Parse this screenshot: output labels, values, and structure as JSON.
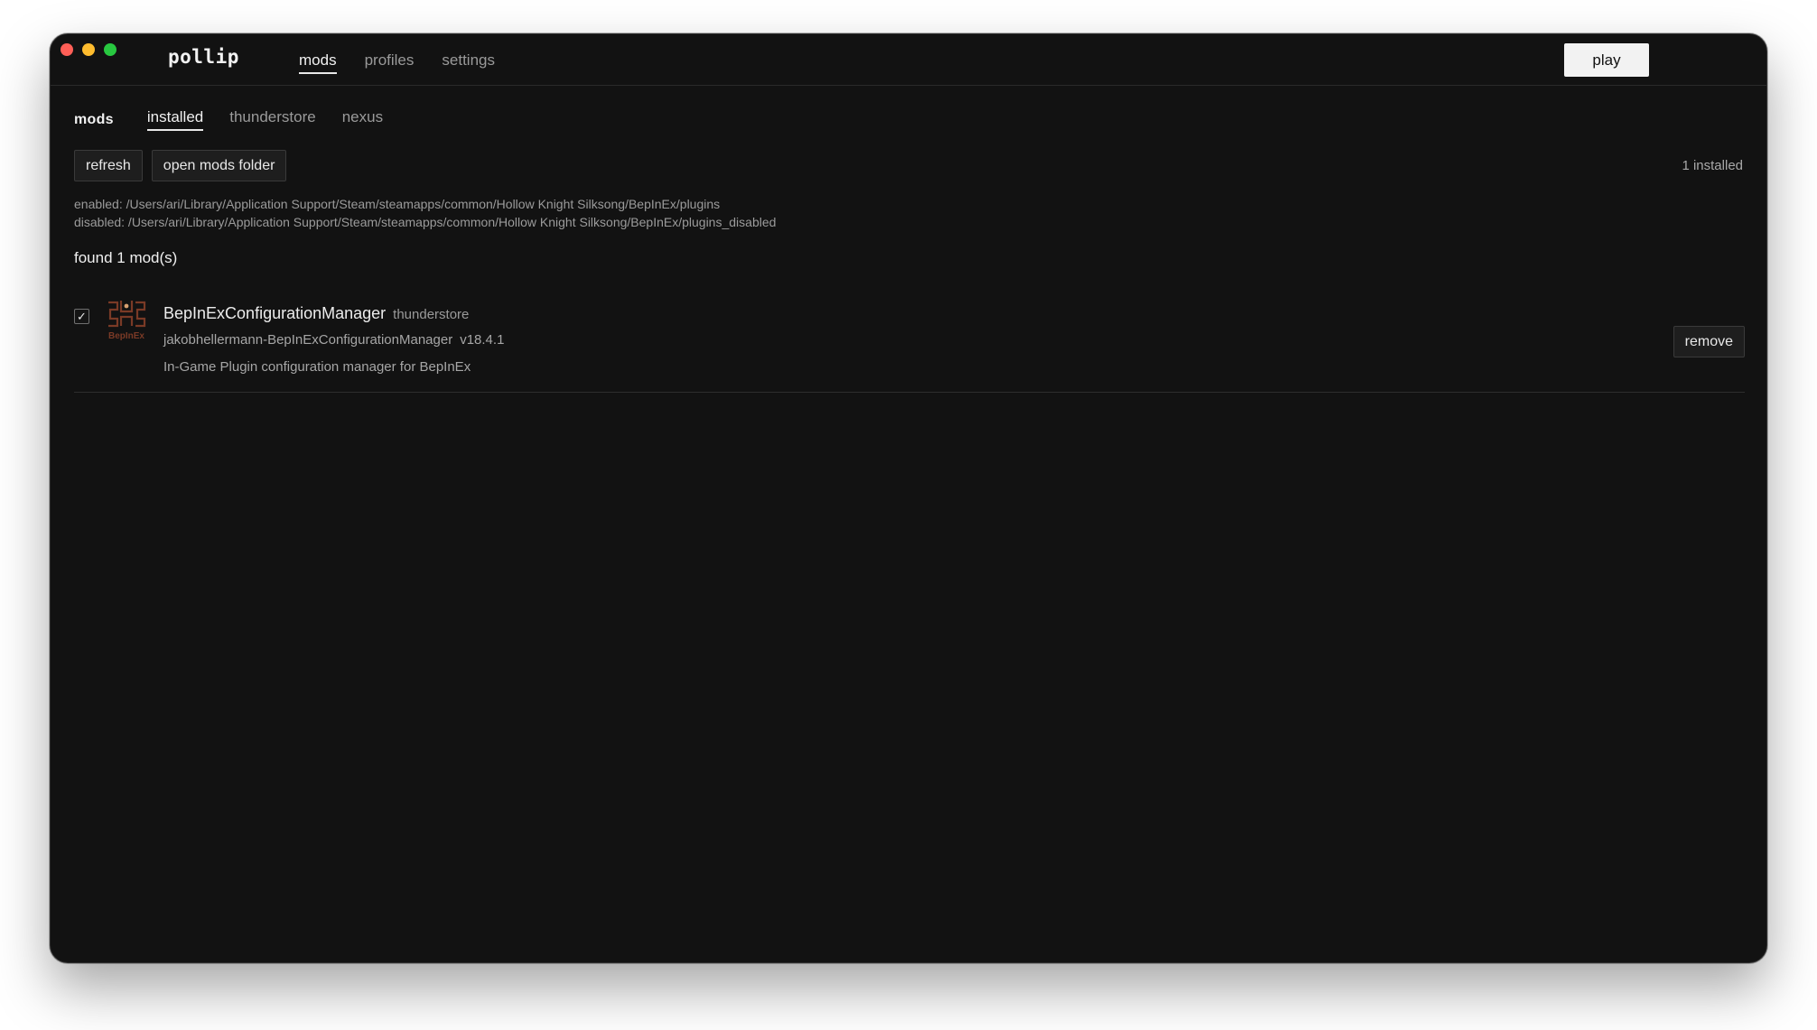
{
  "window": {
    "controls": [
      "close",
      "minimize",
      "zoom"
    ]
  },
  "app": {
    "brand": "pollip",
    "nav": [
      {
        "label": "mods",
        "active": true
      },
      {
        "label": "profiles",
        "active": false
      },
      {
        "label": "settings",
        "active": false
      }
    ],
    "play_label": "play"
  },
  "mods_page": {
    "title": "mods",
    "tabs": [
      {
        "label": "installed",
        "active": true
      },
      {
        "label": "thunderstore",
        "active": false
      },
      {
        "label": "nexus",
        "active": false
      }
    ],
    "refresh_label": "refresh",
    "open_folder_label": "open mods folder",
    "installed_count": "1 installed",
    "enabled_path": "enabled: /Users/ari/Library/Application Support/Steam/steamapps/common/Hollow Knight Silksong/BepInEx/plugins",
    "disabled_path": "disabled: /Users/ari/Library/Application Support/Steam/steamapps/common/Hollow Knight Silksong/BepInEx/plugins_disabled",
    "found_text": "found 1 mod(s)",
    "mods": [
      {
        "checked": true,
        "check_glyph": "✓",
        "icon": "bepinex-logo-icon",
        "icon_text": "BepInEx",
        "name": "BepInExConfigurationManager",
        "source": "thunderstore",
        "full_name": "jakobhellermann-BepInExConfigurationManager",
        "version": "v18.4.1",
        "description": "In-Game Plugin configuration manager for BepInEx",
        "remove_label": "remove"
      }
    ]
  },
  "colors": {
    "background": "#121212",
    "text": "#e6e6e6",
    "muted": "#9a9a9a",
    "play_bg": "#f2f2f2",
    "traffic_red": "#ff5f57",
    "traffic_yellow": "#febc2e",
    "traffic_green": "#28c840"
  }
}
